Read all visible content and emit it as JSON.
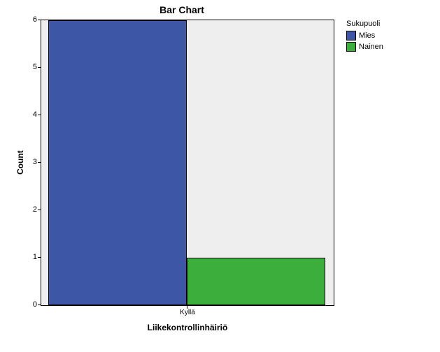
{
  "chart_data": {
    "type": "bar",
    "title": "Bar Chart",
    "xlabel": "Liikekontrollinhäiriö",
    "ylabel": "Count",
    "ylim": [
      0,
      6
    ],
    "yticks": [
      0,
      1,
      2,
      3,
      4,
      5,
      6
    ],
    "categories": [
      "Kyllä"
    ],
    "legend_title": "Sukupuoli",
    "series": [
      {
        "name": "Mies",
        "values": [
          6
        ],
        "color": "#3d57a6"
      },
      {
        "name": "Nainen",
        "values": [
          1
        ],
        "color": "#3bae3b"
      }
    ]
  }
}
